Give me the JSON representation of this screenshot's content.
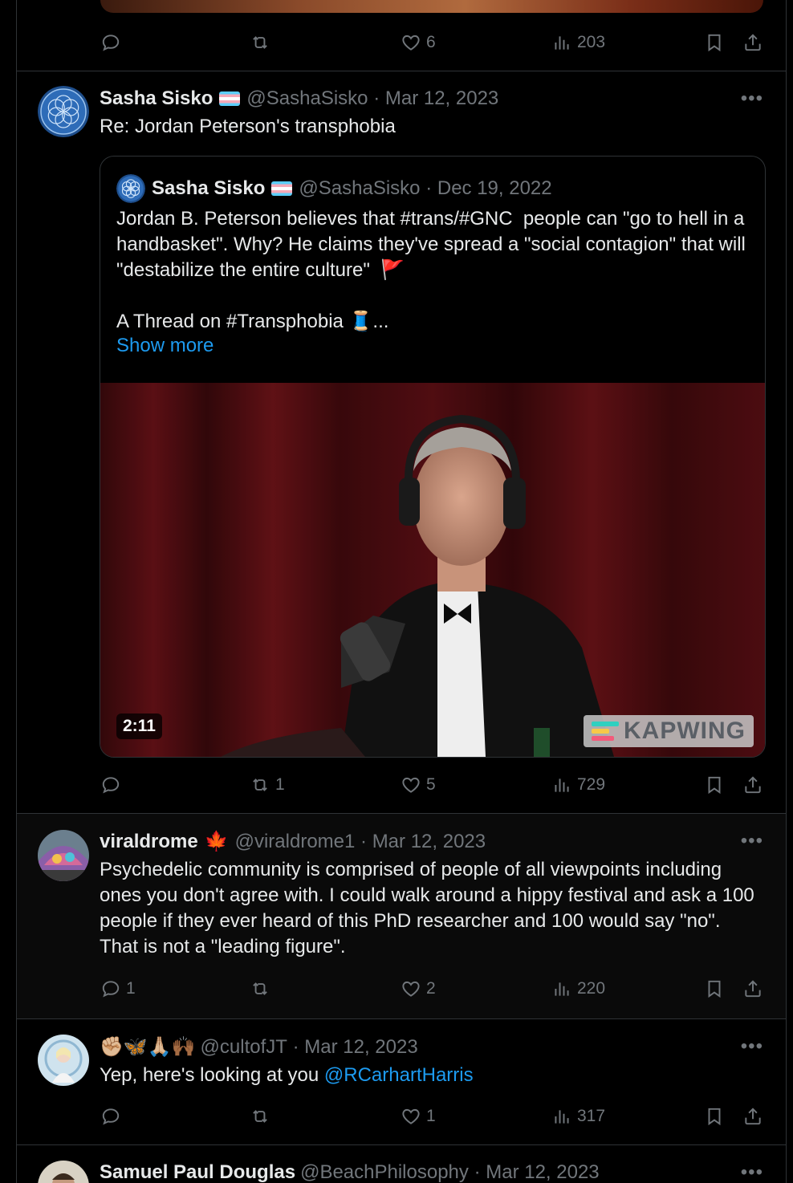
{
  "top_post": {
    "actions": {
      "reply": "",
      "repost": "",
      "like": "6",
      "views": "203"
    }
  },
  "tweets": [
    {
      "name": "Sasha Sisko",
      "handle": "@SashaSisko",
      "date": "Mar 12, 2023",
      "text": "Re: Jordan Peterson's transphobia",
      "quote": {
        "name": "Sasha Sisko",
        "handle": "@SashaSisko",
        "date": "Dec 19, 2022",
        "text": "Jordan B. Peterson believes that #trans/#GNC  people can \"go to hell in a handbasket\". Why? He claims they've spread a \"social contagion\" that will \"destabilize the entire culture\"  🚩\n\nA Thread on #Transphobia 🧵...",
        "show_more": "Show more",
        "video_duration": "2:11",
        "watermark": "KAPWING"
      },
      "actions": {
        "reply": "",
        "repost": "1",
        "like": "5",
        "views": "729"
      }
    },
    {
      "name": "viraldrome",
      "name_emoji": "🍁",
      "handle": "@viraldrome1",
      "date": "Mar 12, 2023",
      "text": "Psychedelic community is comprised of people of all viewpoints including ones you don't agree with. I could walk around a hippy festival and ask a 100 people if they ever heard of this PhD researcher and 100 would say \"no\". That is not a \"leading figure\".",
      "actions": {
        "reply": "1",
        "repost": "",
        "like": "2",
        "views": "220"
      }
    },
    {
      "name": "✊🏼🦋🙏🏼🙌🏾",
      "handle": "@cultofJT",
      "date": "Mar 12, 2023",
      "text": "Yep, here's looking at you ",
      "mention": "@RCarhartHarris",
      "actions": {
        "reply": "",
        "repost": "",
        "like": "1",
        "views": "317"
      }
    },
    {
      "name": "Samuel Paul Douglas",
      "handle": "@BeachPhilosophy",
      "date": "Mar 12, 2023"
    }
  ],
  "colors": {
    "accent": "#1d9bf0",
    "muted": "#71767b",
    "border": "#2f3336",
    "background": "#000000"
  },
  "icons": [
    "reply-icon",
    "repost-icon",
    "like-icon",
    "views-icon",
    "bookmark-icon",
    "share-icon",
    "more-icon"
  ]
}
